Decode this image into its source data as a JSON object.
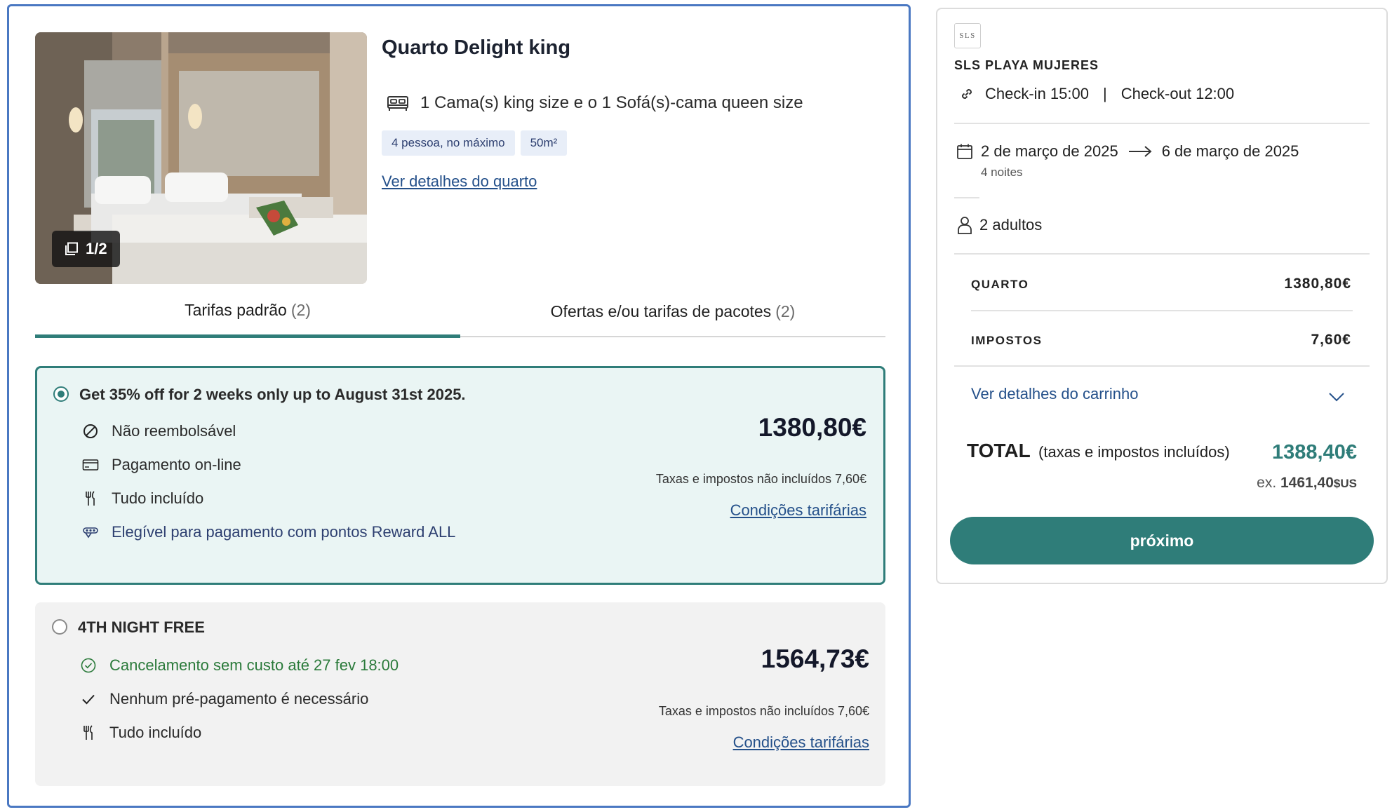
{
  "room": {
    "title": "Quarto Delight king",
    "beds": "1 Cama(s) king size e o 1 Sofá(s)-cama queen size",
    "capacity": "4 pessoa, no máximo",
    "size": "50m²",
    "details_link": "Ver detalhes do quarto",
    "photo_counter": "1/2"
  },
  "tabs": [
    {
      "label": "Tarifas padrão",
      "count": "(2)",
      "active": true
    },
    {
      "label": "Ofertas e/ou tarifas de pacotes",
      "count": "(2)",
      "active": false
    }
  ],
  "rates": [
    {
      "name": "Get 35% off for 2 weeks only up to August 31st 2025.",
      "selected": true,
      "features": [
        {
          "icon": "no-refund-icon",
          "text": "Não reembolsável"
        },
        {
          "icon": "credit-card-icon",
          "text": "Pagamento on-line"
        },
        {
          "icon": "fork-knife-icon",
          "text": "Tudo incluído"
        },
        {
          "icon": "reward-icon",
          "text": "Elegível para pagamento com pontos Reward ALL"
        }
      ],
      "price": "1380,80€",
      "tax_note": "Taxas e impostos não incluídos 7,60€",
      "conditions_link": "Condições tarifárias"
    },
    {
      "name": "4TH NIGHT FREE",
      "selected": false,
      "features": [
        {
          "icon": "check-circle-icon",
          "text": "Cancelamento sem custo até 27 fev 18:00"
        },
        {
          "icon": "check-icon",
          "text": "Nenhum pré-pagamento é necessário"
        },
        {
          "icon": "fork-knife-icon",
          "text": "Tudo incluído"
        }
      ],
      "price": "1564,73€",
      "tax_note": "Taxas e impostos não incluídos 7,60€",
      "conditions_link": "Condições tarifárias"
    }
  ],
  "cart": {
    "logo_text": "SLS",
    "hotel_name": "SLS PLAYA MUJERES",
    "checkin": "Check-in 15:00",
    "separator": "|",
    "checkout": "Check-out 12:00",
    "date_from": "2 de março de 2025",
    "date_to": "6 de março de 2025",
    "nights": "4 noites",
    "guests": "2 adultos",
    "room_label": "QUARTO",
    "room_value": "1380,80€",
    "tax_label": "IMPOSTOS",
    "tax_value": "7,60€",
    "details_link": "Ver detalhes do carrinho",
    "total_label": "TOTAL",
    "total_sub": "(taxas e impostos incluídos)",
    "total_value": "1388,40€",
    "usd_prefix": "ex.",
    "usd_value": "1461,40",
    "usd_unit": "$US",
    "next_label": "próximo"
  },
  "colors": {
    "accent": "#2f7d79",
    "card_border": "#4a78c2",
    "link": "#24508a",
    "selected_bg": "#eaf5f4"
  }
}
